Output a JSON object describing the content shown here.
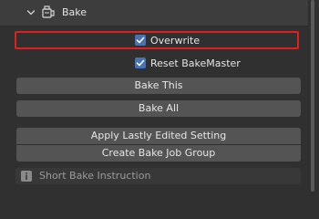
{
  "panel": {
    "title": "Bake",
    "expand_icon": "chevron-down-icon",
    "header_icon": "bake-icon"
  },
  "options": {
    "overwrite": {
      "label": "Overwrite",
      "checked": true
    },
    "reset_bakemaster": {
      "label": "Reset BakeMaster",
      "checked": true
    }
  },
  "buttons": {
    "bake_this": "Bake This",
    "bake_all": "Bake All",
    "apply_lastly_edited": "Apply Lastly Edited Setting",
    "create_bake_job_group": "Create Bake Job Group"
  },
  "info": {
    "icon": "info-icon",
    "label": "Short Bake Instruction"
  },
  "colors": {
    "panel_bg": "#303030",
    "header_bg": "#3d3d3d",
    "button_bg": "#545454",
    "checkbox_accent": "#4772b3",
    "highlight": "#e02020"
  }
}
